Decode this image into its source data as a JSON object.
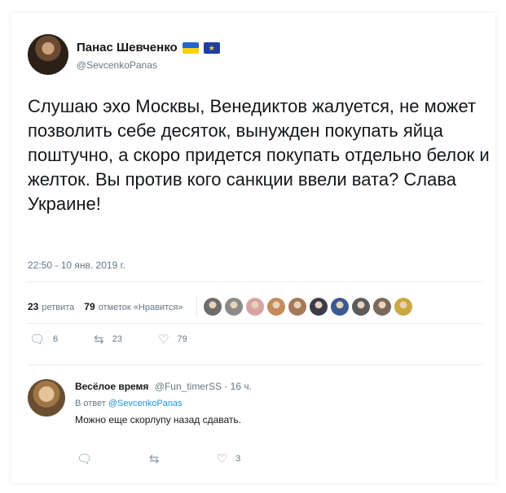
{
  "tweet": {
    "display_name": "Панас Шевченко",
    "handle": "@SevcenkoPanas",
    "text": "Слушаю эхо Москвы, Венедиктов жалуется, не может позволить себе десяток, вынужден покупать яйца поштучно, а скоро придется покупать отдельно белок и желток. Вы против кого санкции ввели вата? Слава Украине!",
    "timestamp": "22:50 - 10 янв. 2019 г.",
    "retweets_count": "23",
    "retweets_label": "ретвита",
    "likes_count": "79",
    "likes_label": "отметок «Нравится»",
    "actions": {
      "reply_count": "6",
      "retweet_count": "23",
      "like_count": "79"
    },
    "flags": [
      "ukraine-flag",
      "eu-flag"
    ]
  },
  "likers": [
    {
      "color": "#6d6d6d"
    },
    {
      "color": "#8a8a8a"
    },
    {
      "color": "#d9a3a3"
    },
    {
      "color": "#c58a5a"
    },
    {
      "color": "#a5785a"
    },
    {
      "color": "#3c3c48"
    },
    {
      "color": "#3b5a8f"
    },
    {
      "color": "#5c5c5c"
    },
    {
      "color": "#7a6a5c"
    },
    {
      "color": "#c9a83d"
    }
  ],
  "reply": {
    "display_name": "Весёлое время",
    "handle": "@Fun_timerSS",
    "time": "· 16 ч.",
    "in_reply_prefix": "В ответ",
    "in_reply_handle": "@SevcenkoPanas",
    "text": "Можно еще скорлупу назад сдавать.",
    "actions": {
      "reply_count": "",
      "retweet_count": "",
      "like_count": "3"
    }
  },
  "colors": {
    "accent": "#1b95e0",
    "secondary_text": "#657786",
    "divider": "#e6ecf0"
  }
}
